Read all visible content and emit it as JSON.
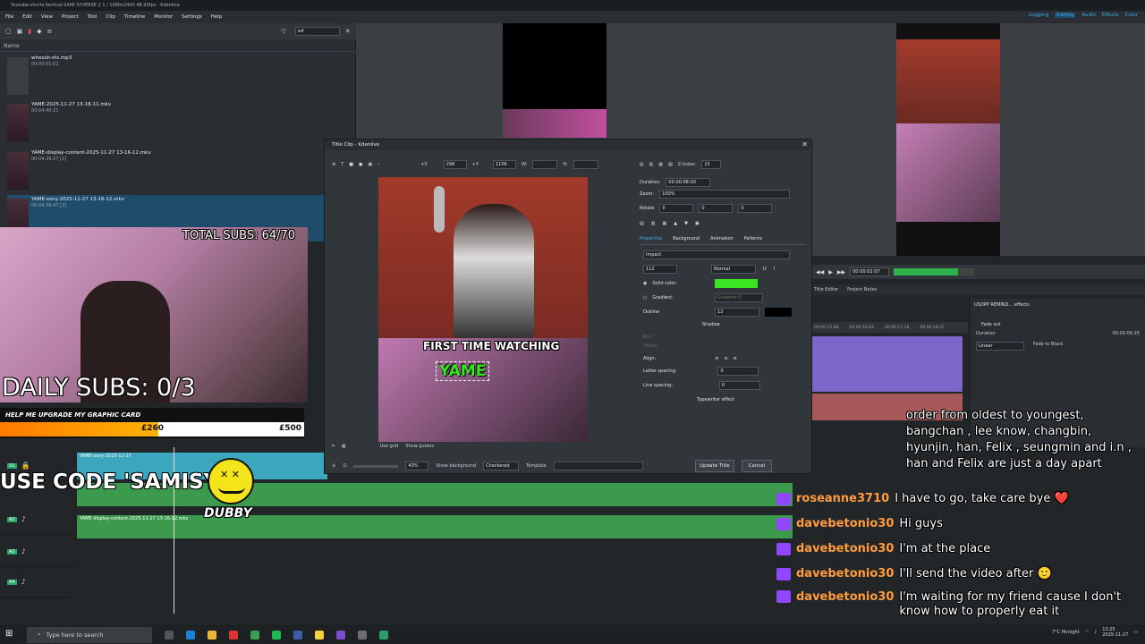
{
  "window": {
    "title": "Youtube-shorts-Vertical-SAMI SYVERSE 1 1 / 1080x2400 48.93fps - Kdenlive"
  },
  "menu": [
    "File",
    "Edit",
    "View",
    "Project",
    "Tool",
    "Clip",
    "Timeline",
    "Monitor",
    "Settings",
    "Help"
  ],
  "layouts": {
    "items": [
      "Logging",
      "Editing",
      "Audio",
      "Effects",
      "Color"
    ],
    "active": "Editing"
  },
  "bin": {
    "search_value": "ssf",
    "header": "Name",
    "clips": [
      {
        "name": "whoosh-sfx.mp3",
        "duration": "00:00:01:01"
      },
      {
        "name": "YAME-2025-11-27 13-16-11.mkv",
        "duration": "00:04:40:21"
      },
      {
        "name": "YAME-display-content-2025-11-27 13-16-12.mkv",
        "duration": "00:04:39:27 [2]"
      },
      {
        "name": "YAME-sony-2025-11-27 13-16-12.mkv",
        "duration": "00:04:39:47 [2]"
      }
    ]
  },
  "stream": {
    "total_subs": "TOTAL SUBS: 64/70",
    "daily_subs": "DAILY SUBS: 0/3",
    "goal_title": "HELP ME UPGRADE MY GRAPHIC CARD",
    "goal_current": "£260",
    "goal_target": "£500",
    "goal_progress": 0.52,
    "code": "USE CODE 'SAMISY'",
    "brand": "DUBBY"
  },
  "dialog": {
    "title": "Title Clip - Kdenlive",
    "x_label": "+X",
    "x_value": "298",
    "y_label": "+Y",
    "y_value": "1156",
    "w_label": "W:",
    "h_label": "H:",
    "zindex_label": "Z-Index:",
    "zindex_value": "15",
    "duration_label": "Duration:",
    "duration_value": "00:00:08:00",
    "zoom_label": "Zoom:",
    "zoom_value": "100%",
    "rotate_label": "Rotate",
    "rx": "0",
    "ry": "0",
    "rz": "0",
    "tabs": [
      "Properties",
      "Background",
      "Animation",
      "Patterns"
    ],
    "font": "Impact",
    "font_size": "112",
    "weight": "Normal",
    "solid_color_label": "Solid color:",
    "solid_color": "#39e622",
    "gradient_label": "Gradient:",
    "gradient_value": "Gradient 0",
    "outline_label": "Outline",
    "outline_value": "12",
    "shadow_label": "Shadow",
    "blur_label": "Blur:",
    "offset_label": "Offset:",
    "align_label": "Align:",
    "letter_spacing_label": "Letter spacing:",
    "letter_spacing": "0",
    "line_spacing_label": "Line spacing:",
    "line_spacing": "0",
    "typewriter_label": "Typewriter effect",
    "use_grid": "Use grid",
    "show_guides": "Show guides",
    "zoom_pct": "43%",
    "show_background": "Show background",
    "checkered": "Checkered",
    "template_label": "Template",
    "update_button": "Update Title",
    "cancel_button": "Cancel",
    "canvas_text1": "FIRST TIME WATCHING",
    "canvas_text2": "YAME"
  },
  "monitor": {
    "timecode": "00:00:02:07",
    "tabs": [
      "Title Editor",
      "Project Notes"
    ]
  },
  "effects": {
    "header": "USOPP REMIND... effects",
    "fade_out": "Fade out",
    "duration_label": "Duration",
    "duration_value": "00:00:00:25",
    "linear": "Linear",
    "fade_black": "Fade to Black"
  },
  "ruler": [
    "00:00:15:48",
    "00:00:16:03",
    "00:00:17:18",
    "00:00:18:37"
  ],
  "tracks": [
    {
      "name": "V1",
      "clip": "YAME-sony-2025-11-27"
    },
    {
      "name": "A2",
      "clip": "YAME-display-content-2025-11-27 13-16-12.mkv"
    },
    {
      "name": "A3",
      "clip": ""
    },
    {
      "name": "A4",
      "clip": ""
    }
  ],
  "chat": [
    {
      "user": "",
      "message": "order from oldest to youngest, bangchan , lee know, changbin, hyunjin, han, Felix , seungmin and i.n , han and Felix are just a day apart"
    },
    {
      "user": "roseanne3710",
      "message": "I have to go, take care bye ❤️"
    },
    {
      "user": "davebetonio30",
      "message": "Hi guys"
    },
    {
      "user": "davebetonio30",
      "message": "I'm at the place"
    },
    {
      "user": "davebetonio30",
      "message": "I'll send the video after 🙂"
    },
    {
      "user": "davebetonio30",
      "message": "I'm waiting for my friend cause I don't know how to properly eat it"
    }
  ],
  "taskbar": {
    "search_placeholder": "Type here to search",
    "weather": "7°C Mcnight",
    "time": "13:25",
    "date": "2025-11-27"
  }
}
